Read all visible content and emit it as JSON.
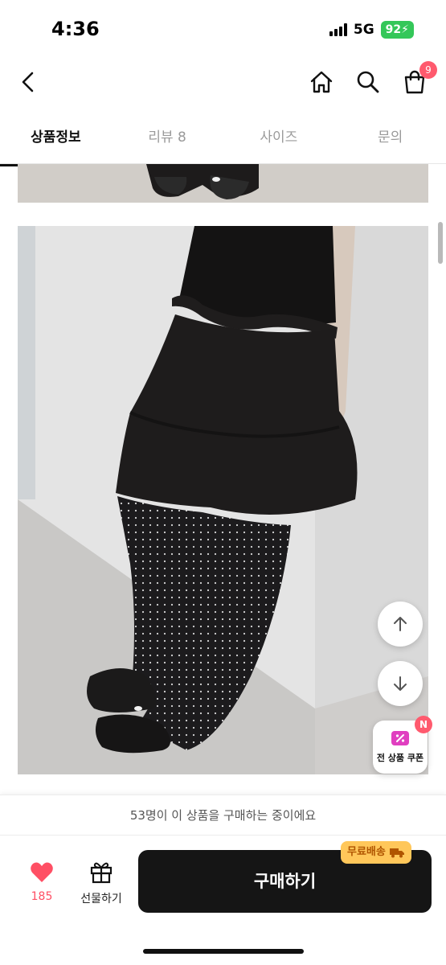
{
  "status_bar": {
    "time": "4:36",
    "network": "5G",
    "battery": "92"
  },
  "header": {
    "cart_count": "9"
  },
  "tabs": [
    {
      "label": "상품정보"
    },
    {
      "label": "리뷰 8"
    },
    {
      "label": "사이즈"
    },
    {
      "label": "문의"
    }
  ],
  "coupon": {
    "label": "전 상품 쿠폰",
    "badge": "N"
  },
  "purchase_banner": "53명이 이 상품을 구매하는 중이에요",
  "bottom_bar": {
    "like_count": "185",
    "gift_label": "선물하기",
    "buy_label": "구매하기",
    "free_shipping_label": "무료배송"
  },
  "colors": {
    "accent": "#ff5a6e",
    "buy_button": "#151515",
    "free_shipping": "#ffc75a"
  },
  "icons": [
    "back-icon",
    "home-icon",
    "search-icon",
    "cart-icon",
    "arrow-up-icon",
    "arrow-down-icon",
    "coupon-icon",
    "heart-icon",
    "gift-icon",
    "truck-icon"
  ]
}
